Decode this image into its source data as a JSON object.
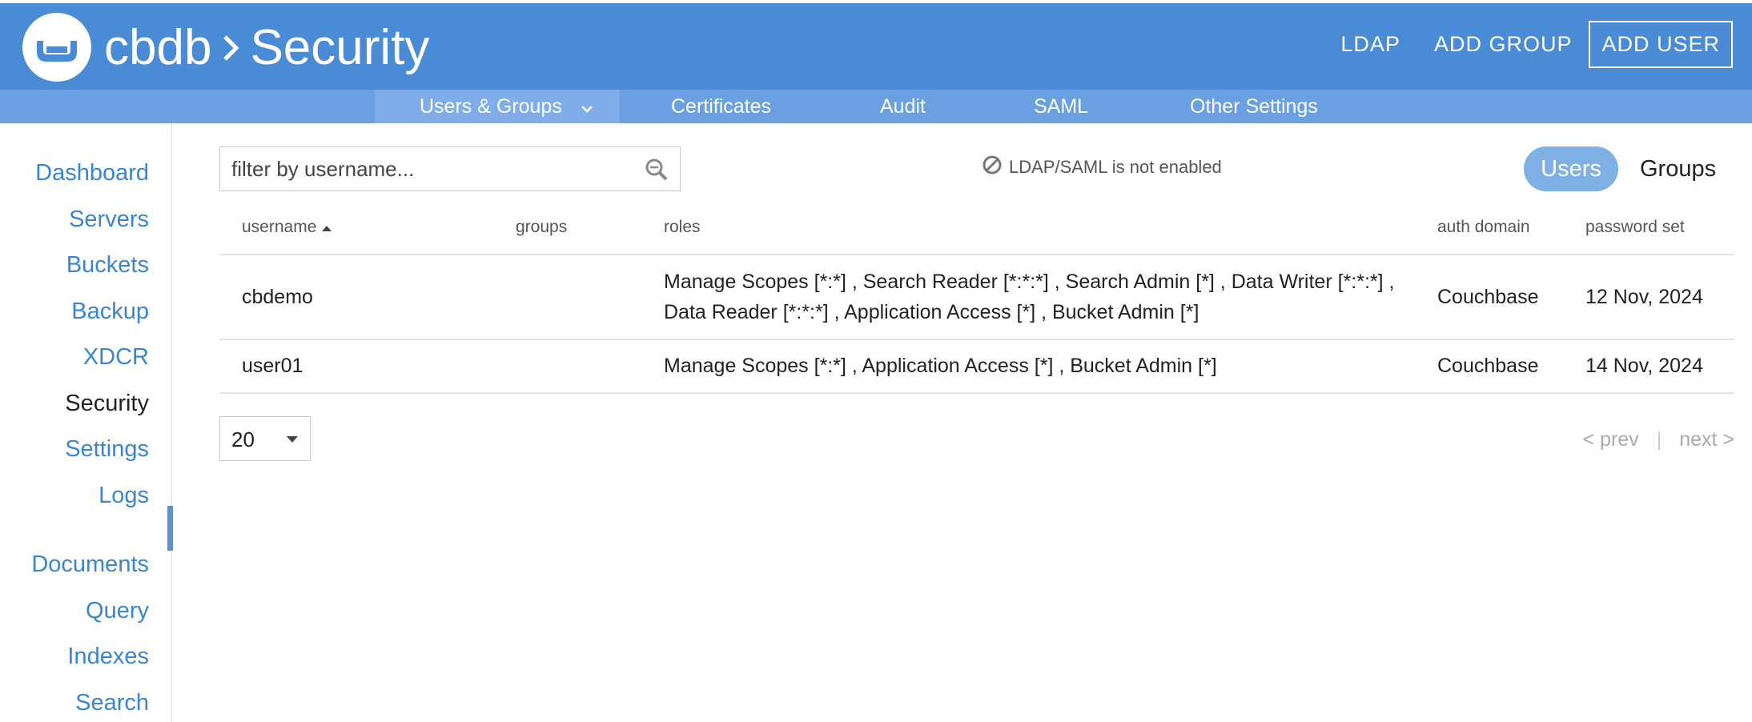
{
  "header": {
    "cluster": "cbdb",
    "section": "Security",
    "actions": {
      "ldap": "LDAP",
      "add_group": "ADD GROUP",
      "add_user": "ADD USER"
    },
    "brand_color": "#4a8bd6"
  },
  "subnav": {
    "items": [
      "Users & Groups",
      "Certificates",
      "Audit",
      "SAML",
      "Other Settings"
    ],
    "active": "Users & Groups"
  },
  "sidebar": {
    "items": [
      "Dashboard",
      "Servers",
      "Buckets",
      "Backup",
      "XDCR",
      "Security",
      "Settings",
      "Logs",
      "Documents",
      "Query",
      "Indexes",
      "Search"
    ],
    "active": "Security"
  },
  "filter": {
    "placeholder": "filter by username..."
  },
  "ldap_status": "LDAP/SAML is not enabled",
  "view_toggle": {
    "users": "Users",
    "groups": "Groups",
    "active": "Users"
  },
  "table": {
    "columns": [
      "username",
      "groups",
      "roles",
      "auth domain",
      "password set"
    ],
    "sort": "username ascending",
    "rows": [
      {
        "username": "cbdemo",
        "groups": "",
        "roles": "Manage Scopes [*:*] , Search Reader [*:*:*] , Search Admin [*] , Data Writer [*:*:*] , Data Reader [*:*:*] , Application Access [*] , Bucket Admin [*]",
        "auth_domain": "Couchbase",
        "password_set": "12 Nov, 2024"
      },
      {
        "username": "user01",
        "groups": "",
        "roles": "Manage Scopes [*:*] , Application Access [*] , Bucket Admin [*]",
        "auth_domain": "Couchbase",
        "password_set": "14 Nov, 2024"
      }
    ]
  },
  "pagination": {
    "page_size": "20",
    "prev": "< prev",
    "next": "next >"
  }
}
